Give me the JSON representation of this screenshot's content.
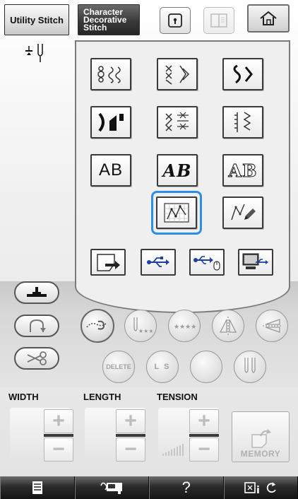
{
  "tabs": {
    "utility": "Utility Stitch",
    "character_line1": "Character",
    "character_line2": "Decorative",
    "character_line3": "Stitch"
  },
  "pattern_grid": {
    "row3": {
      "ab_plain": "AB",
      "ab_script": "AB",
      "ab_outline": "AB"
    }
  },
  "function_buttons": {
    "delete_label": "DELETE",
    "ls_label": "L S"
  },
  "settings": {
    "width_label": "WIDTH",
    "length_label": "LENGTH",
    "tension_label": "TENSION",
    "plus_symbol": "+",
    "minus_symbol": "−"
  },
  "memory": {
    "label": "MEMORY"
  },
  "bottom_bar": {
    "help_label": "?"
  },
  "colors": {
    "selection_accent": "#2d8ee8",
    "usb_icon_blue": "#1c3faa",
    "bottom_bar": "#1e1e1e"
  },
  "icons": [
    "lock-open-icon",
    "book-icon",
    "home-icon",
    "needle-position-icon",
    "decorative-stitch-icon",
    "usb-icon",
    "usb-mouse-icon",
    "pc-connection-icon",
    "pocket-arrow-icon",
    "presser-foot-icon",
    "reverse-stitch-icon",
    "scissors-icon",
    "document-icon",
    "embroidery-frame-icon",
    "refresh-icon"
  ]
}
